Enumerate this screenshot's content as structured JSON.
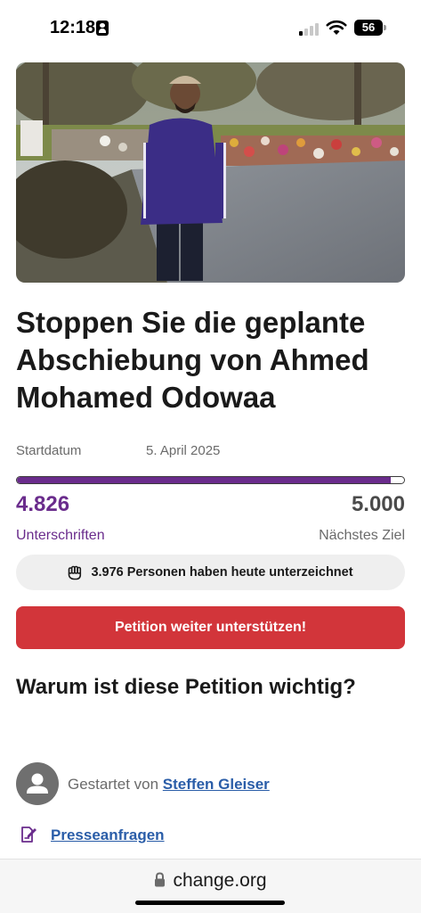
{
  "status_bar": {
    "time": "12:18",
    "battery": "56"
  },
  "petition": {
    "title": "Stoppen Sie die geplante Abschiebung von Ahmed Mohamed Odowaa",
    "start_label": "Startdatum",
    "start_date": "5. April 2025",
    "signatures": "4.826",
    "signatures_label": "Unterschriften",
    "goal": "5.000",
    "goal_label": "Nächstes Ziel",
    "progress_fraction": 0.9652,
    "today_text": "3.976 Personen haben heute unterzeichnet",
    "cta_label": "Petition weiter unterstützen!",
    "why_heading": "Warum ist diese Petition wichtig?",
    "started_by_label": "Gestartet von",
    "started_by_name": "Steffen Gleiser",
    "press_link": "Presseanfragen"
  },
  "browser": {
    "url": "change.org"
  },
  "colors": {
    "accent_purple": "#6a2c8c",
    "cta_red": "#d2353a",
    "link_blue": "#2a5da8"
  },
  "icons": {
    "today": "raised-fist-icon",
    "avatar": "user-avatar-icon",
    "press": "press-document-icon",
    "lock": "lock-icon"
  }
}
